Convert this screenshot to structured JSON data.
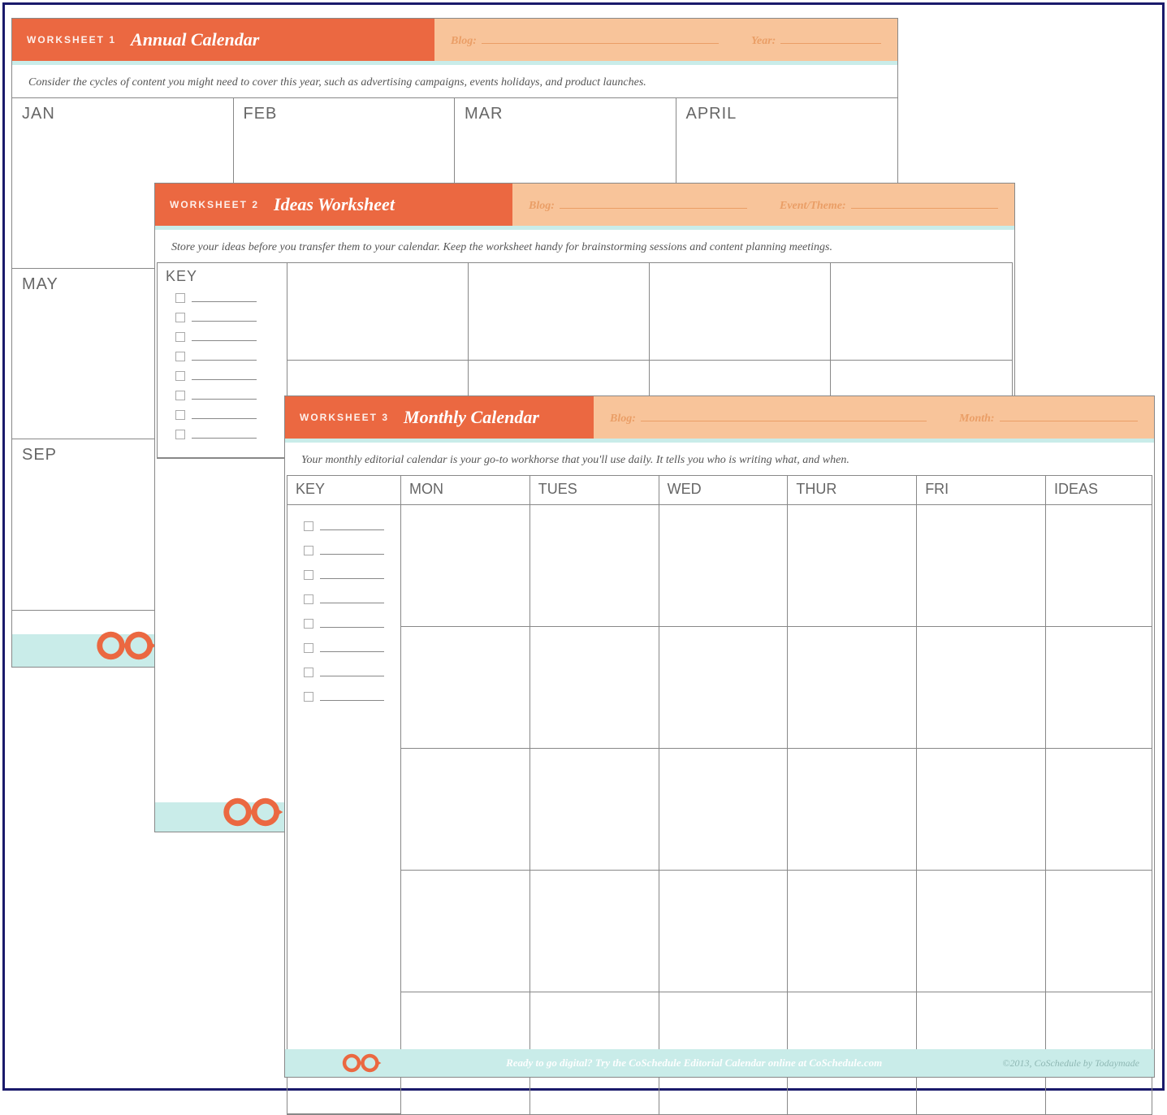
{
  "sheet1": {
    "ws_label": "WORKSHEET 1",
    "title": "Annual Calendar",
    "field_a": "Blog:",
    "field_b": "Year:",
    "description": "Consider the cycles of content you might need to cover this year, such as advertising campaigns, events holidays, and product launches.",
    "months_row1": [
      "JAN",
      "FEB",
      "MAR",
      "APRIL"
    ],
    "months_row2": [
      "MAY",
      "",
      "",
      ""
    ],
    "months_row3": [
      "SEP",
      "",
      "",
      ""
    ]
  },
  "sheet2": {
    "ws_label": "WORKSHEET 2",
    "title": "Ideas Worksheet",
    "field_a": "Blog:",
    "field_b": "Event/Theme:",
    "description": "Store your ideas before you transfer them to your calendar. Keep the worksheet handy for brainstorming sessions and content planning meetings.",
    "key_label": "KEY"
  },
  "sheet3": {
    "ws_label": "WORKSHEET 3",
    "title": "Monthly Calendar",
    "field_a": "Blog:",
    "field_b": "Month:",
    "description": "Your monthly editorial calendar is your go-to workhorse that you'll use daily. It tells you who is writing what, and when.",
    "columns": [
      "KEY",
      "MON",
      "TUES",
      "WED",
      "THUR",
      "FRI",
      "IDEAS"
    ],
    "footer_promo": "Ready to go digital? Try the CoSchedule Editorial Calendar online at CoSchedule.com",
    "footer_copy": "©2013, CoSchedule by Todaymade"
  },
  "logo_color": "#eb6841"
}
